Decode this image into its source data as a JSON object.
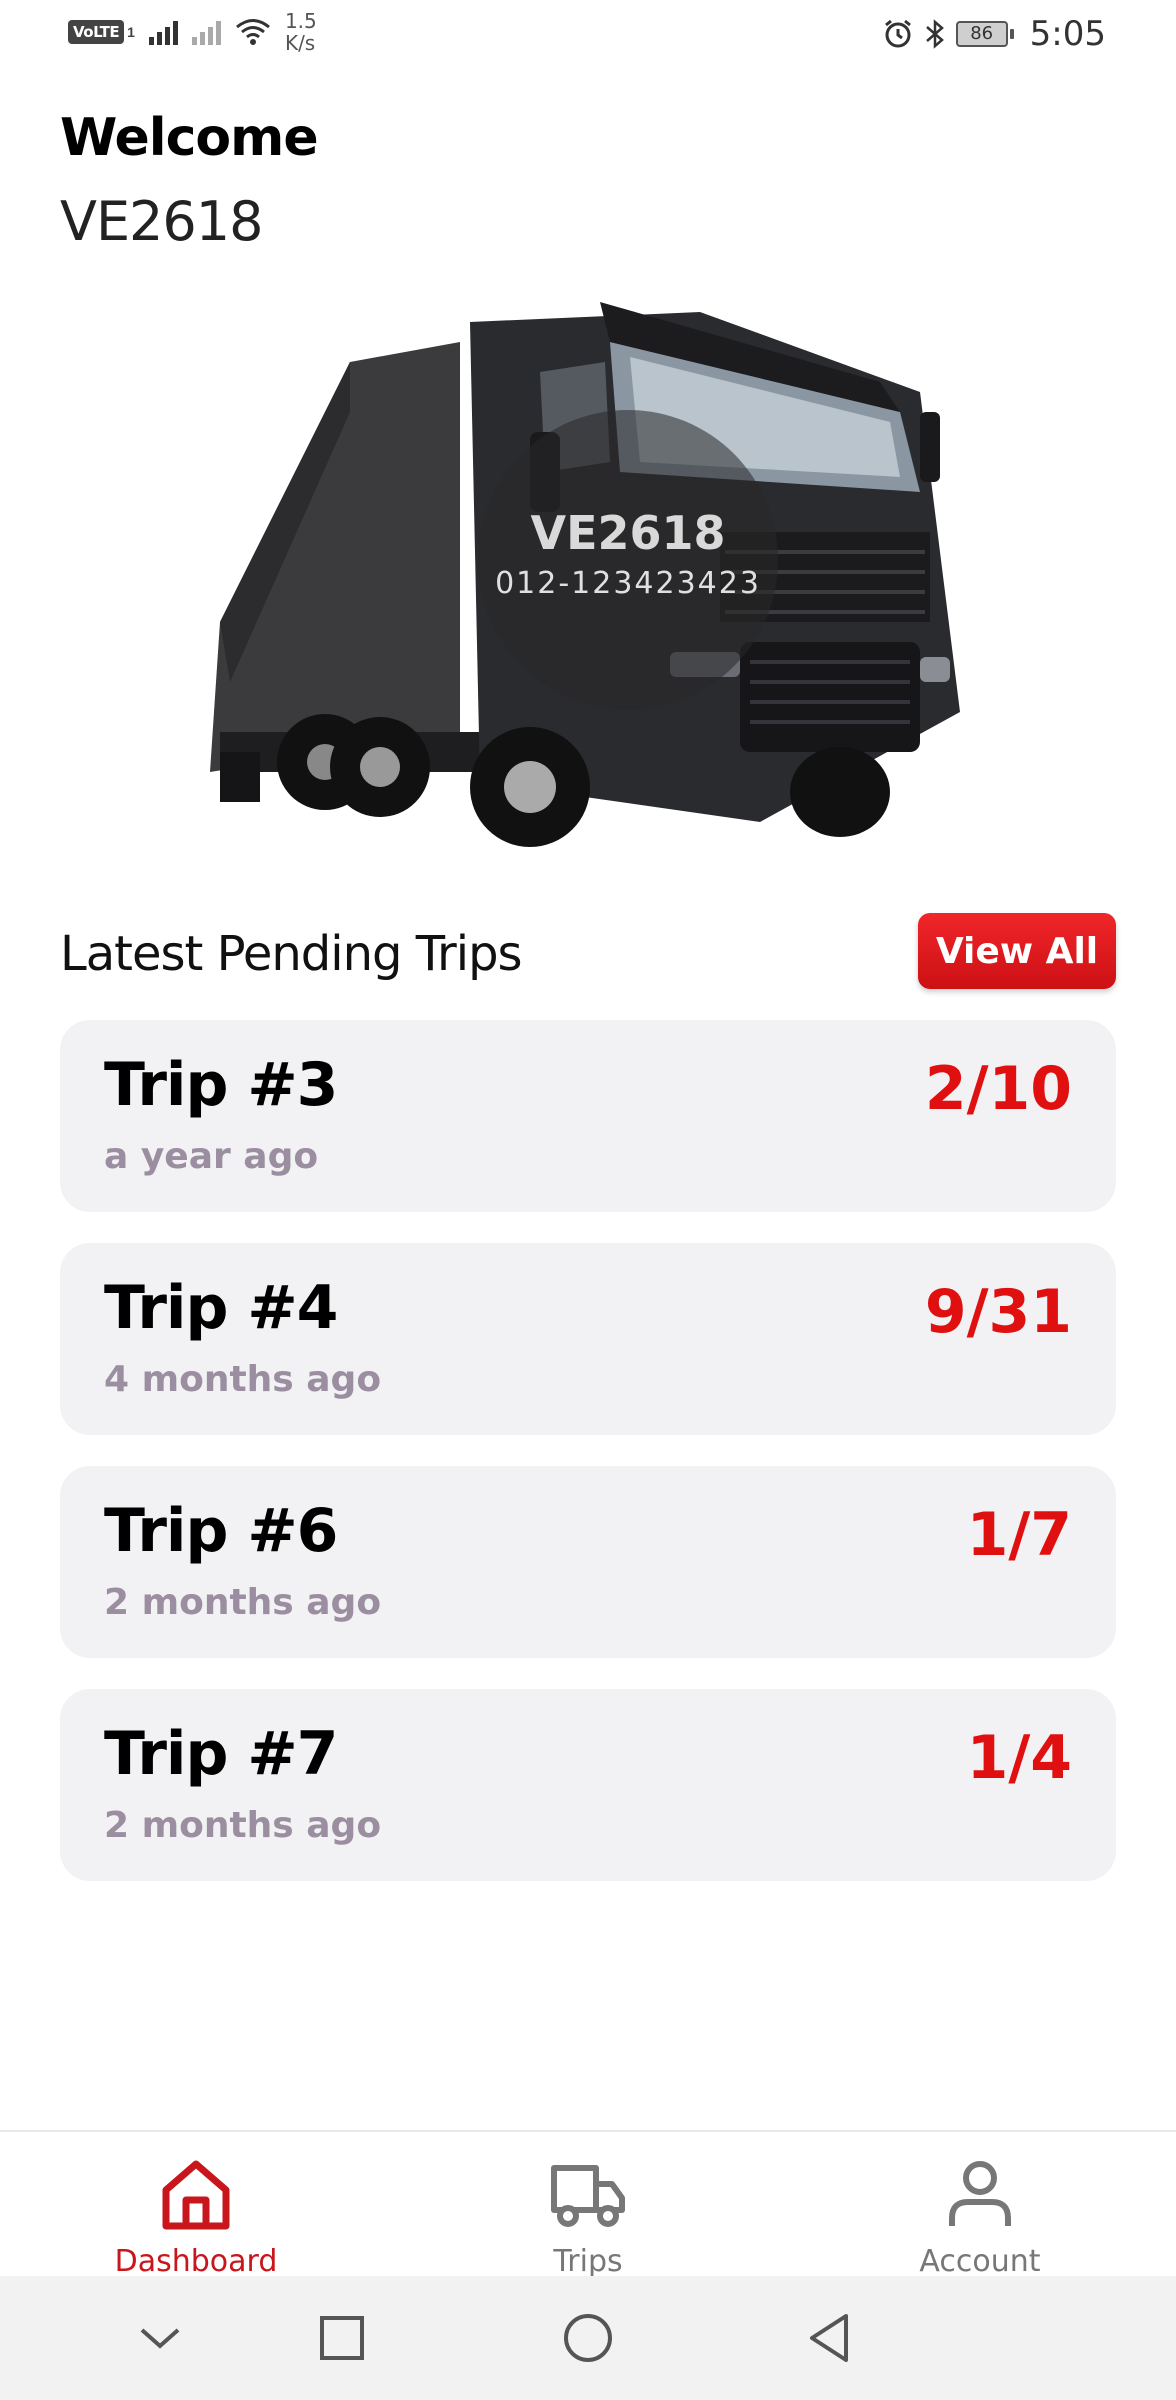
{
  "status_bar": {
    "network_badge": "VoLTE",
    "sim_slot": "1",
    "speed_value": "1.5",
    "speed_unit": "K/s",
    "battery": "86",
    "time": "5:05",
    "icons": [
      "volte-icon",
      "signal-icon",
      "signal-no-sim-icon",
      "wifi-icon",
      "alarm-icon",
      "bluetooth-icon",
      "battery-icon"
    ]
  },
  "header": {
    "welcome": "Welcome",
    "vehicle_id": "VE2618"
  },
  "hero": {
    "badge_title": "VE2618",
    "badge_subtitle": "012-123423423",
    "image": "truck-image"
  },
  "trips_section": {
    "title": "Latest Pending Trips",
    "view_all_label": "View All",
    "trips": [
      {
        "name": "Trip #3",
        "time": "a year ago",
        "count": "2/10"
      },
      {
        "name": "Trip #4",
        "time": "4 months ago",
        "count": "9/31"
      },
      {
        "name": "Trip #6",
        "time": "2 months ago",
        "count": "1/7"
      },
      {
        "name": "Trip #7",
        "time": "2 months ago",
        "count": "1/4"
      }
    ]
  },
  "bottom_nav": {
    "items": [
      {
        "label": "Dashboard",
        "icon": "home-icon",
        "active": true
      },
      {
        "label": "Trips",
        "icon": "truck-icon",
        "active": false
      },
      {
        "label": "Account",
        "icon": "person-icon",
        "active": false
      }
    ]
  },
  "system_nav": {
    "icons": [
      "chevron-down-icon",
      "recents-icon",
      "home-circle-icon",
      "back-icon"
    ]
  },
  "colors": {
    "accent": "#e01010",
    "card_bg": "#f2f1f3",
    "muted_text": "#9b8ea0",
    "nav_active": "#c8161c",
    "nav_inactive": "#777777"
  }
}
